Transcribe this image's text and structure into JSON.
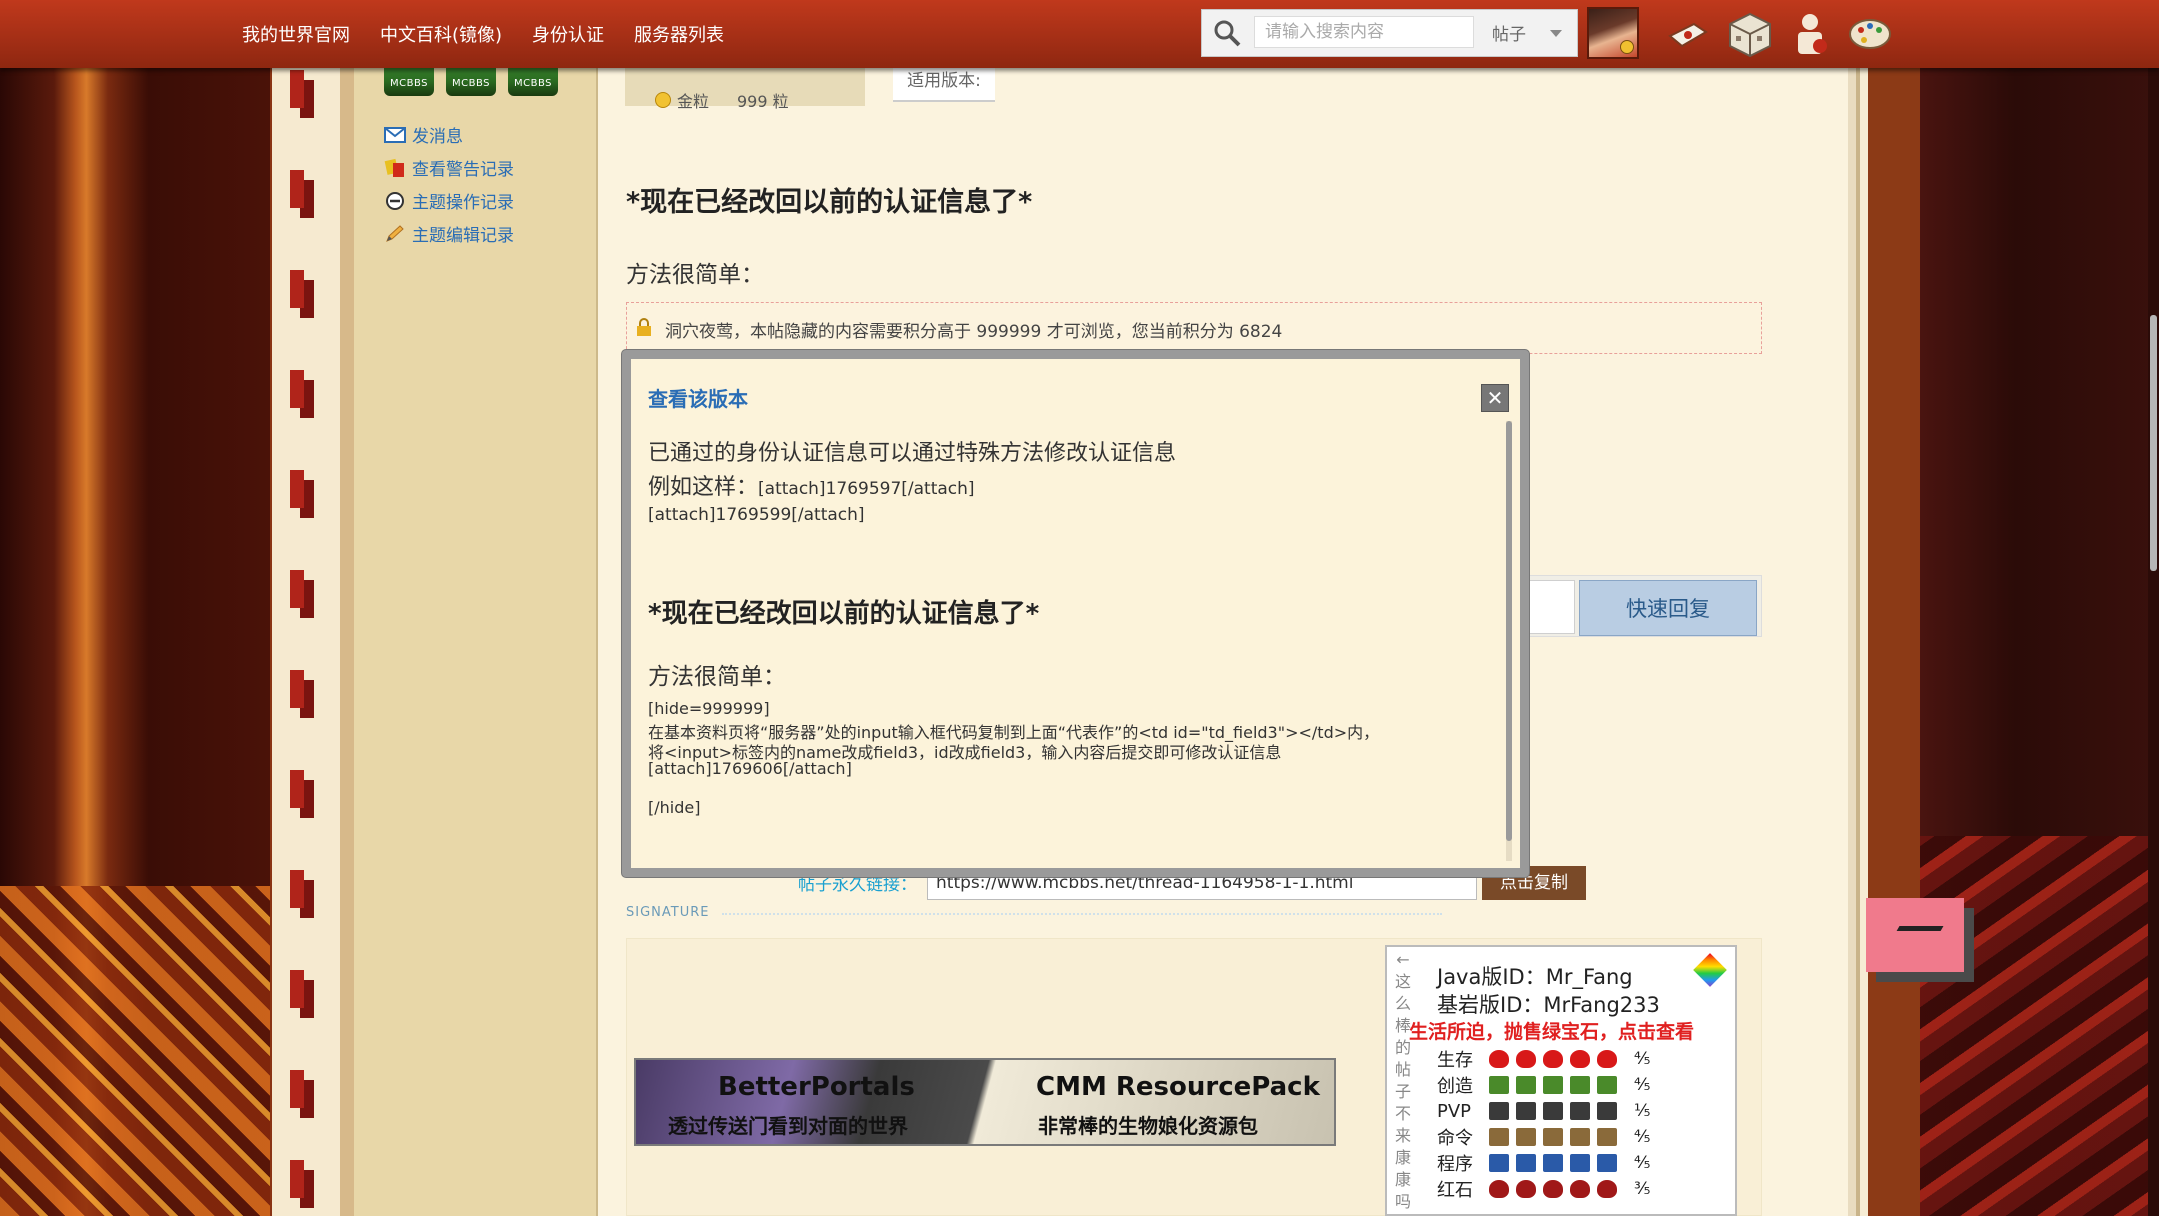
{
  "nav": {
    "links": [
      "我的世界官网",
      "中文百科(镜像)",
      "身份认证",
      "服务器列表"
    ],
    "search_placeholder": "请输入搜索内容",
    "search_type": "帖子"
  },
  "sidebar": {
    "medals": [
      "MCBBS",
      "MCBBS",
      "MCBBS"
    ],
    "links": [
      {
        "label": "发消息",
        "icon": "envelope-icon"
      },
      {
        "label": "查看警告记录",
        "icon": "warning-cards-icon"
      },
      {
        "label": "主题操作记录",
        "icon": "circle-minus-icon"
      },
      {
        "label": "主题编辑记录",
        "icon": "pencil-icon"
      }
    ]
  },
  "author": {
    "coin_label": "金粒",
    "coin_value": "999 粒"
  },
  "version_tab": "适用版本:",
  "post": {
    "heading": "*现在已经改回以前的认证信息了*",
    "method": "方法很简单：",
    "locked_notice": "洞穴夜莺，本帖隐藏的内容需要积分高于 999999 才可浏览，您当前积分为 6824"
  },
  "modal": {
    "title": "查看该版本",
    "close": "✕",
    "line1": "已通过的身份认证信息可以通过特殊方法修改认证信息",
    "line2_lead": "例如这样：",
    "line2_attach": "[attach]1769597[/attach]",
    "line3": "[attach]1769599[/attach]",
    "heading": "*现在已经改回以前的认证信息了*",
    "method": "方法很简单：",
    "hide_open": "[hide=999999]",
    "instruction1": "在基本资料页将“服务器”处的input输入框代码复制到上面“代表作”的<td id=\"td_field3\"></td>内，",
    "instruction2": "将<input>标签内的name改成field3，id改成field3，输入内容后提交即可修改认证信息",
    "attach_last": "[attach]1769606[/attach]",
    "hide_close": "[/hide]"
  },
  "reply": {
    "button": "快速回复"
  },
  "permalink": {
    "label": "帖子永久链接：",
    "url": "https://www.mcbbs.net/thread-1164958-1-1.html",
    "copy": "点击复制"
  },
  "signature": {
    "label": "SIGNATURE",
    "banner_left_title": "BetterPortals",
    "banner_left_sub": "透过传送门看到对面的世界",
    "banner_right_title": "CMM ResourcePack",
    "banner_right_sub": "非常棒的生物娘化资源包",
    "card": {
      "vertical_text": "←这么棒的帖子不来康康吗",
      "java_id": "Java版ID：Mr_Fang",
      "bedrock_id": "基岩版ID：MrFang233",
      "promo": "生活所迫，抛售绿宝石，点击查看",
      "stats": [
        {
          "label": "生存",
          "icon": "heart-icon",
          "score": "⁴⁄₅",
          "color": "#d81818"
        },
        {
          "label": "创造",
          "icon": "pickaxe-icon",
          "score": "⁴⁄₅",
          "color": "#4a8a2a"
        },
        {
          "label": "PVP",
          "icon": "sword-icon",
          "score": "¹⁄₅",
          "color": "#3a3a3a"
        },
        {
          "label": "命令",
          "icon": "command-block-icon",
          "score": "⁴⁄₅",
          "color": "#8a6a3a"
        },
        {
          "label": "程序",
          "icon": "book-icon",
          "score": "⁴⁄₅",
          "color": "#2a5aa8"
        },
        {
          "label": "红石",
          "icon": "redstone-icon",
          "score": "³⁄₅",
          "color": "#a01818"
        }
      ]
    }
  }
}
